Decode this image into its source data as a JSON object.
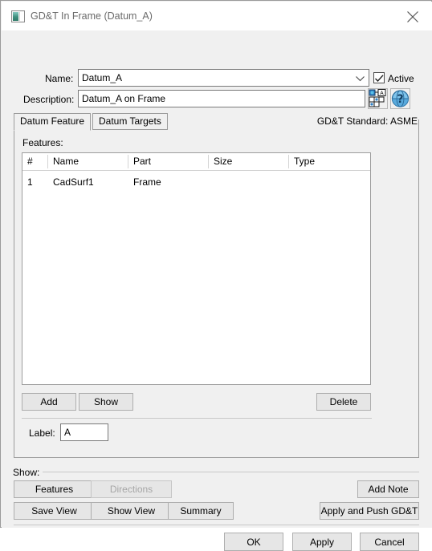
{
  "window": {
    "title": "GD&T In Frame (Datum_A)",
    "icon": "window-document-icon",
    "close_icon": "close-icon"
  },
  "form": {
    "name_label": "Name:",
    "name_value": "Datum_A",
    "name_dropdown_icon": "chevron-down-icon",
    "active_label": "Active",
    "active_checked": true,
    "description_label": "Description:",
    "description_value": "Datum_A on Frame",
    "gdt_symbol_icon": "gdt-feature-control-frame-icon",
    "help_icon": "help-globe-icon"
  },
  "tabs": [
    {
      "label": "Datum Feature",
      "selected": true
    },
    {
      "label": "Datum Targets",
      "selected": false
    }
  ],
  "standard": {
    "text": "GD&T Standard: ASME"
  },
  "features": {
    "section_label": "Features:",
    "columns": [
      "#",
      "Name",
      "Part",
      "Size",
      "Type"
    ],
    "rows": [
      {
        "num": "1",
        "name": "CadSurf1",
        "part": "Frame",
        "size": "",
        "type": ""
      }
    ]
  },
  "feature_buttons": {
    "add": "Add",
    "show": "Show",
    "delete": "Delete"
  },
  "label_field": {
    "label": "Label:",
    "value": "A"
  },
  "show_group": {
    "title": "Show:",
    "features": "Features",
    "directions": "Directions",
    "directions_enabled": false,
    "add_note": "Add Note",
    "save_view": "Save View",
    "show_view": "Show View",
    "summary": "Summary",
    "apply_and_push": "Apply and Push GD&T"
  },
  "dialog_buttons": {
    "ok": "OK",
    "apply": "Apply",
    "cancel": "Cancel"
  },
  "colors": {
    "window_bg": "#f0f0f0",
    "titlebar_bg": "#ffffff",
    "title_text": "#6b6b6b",
    "border": "#9c9c9c",
    "button_face": "#e6e6e6",
    "disabled_text": "#a6a6a6",
    "field_bg": "#ffffff"
  }
}
